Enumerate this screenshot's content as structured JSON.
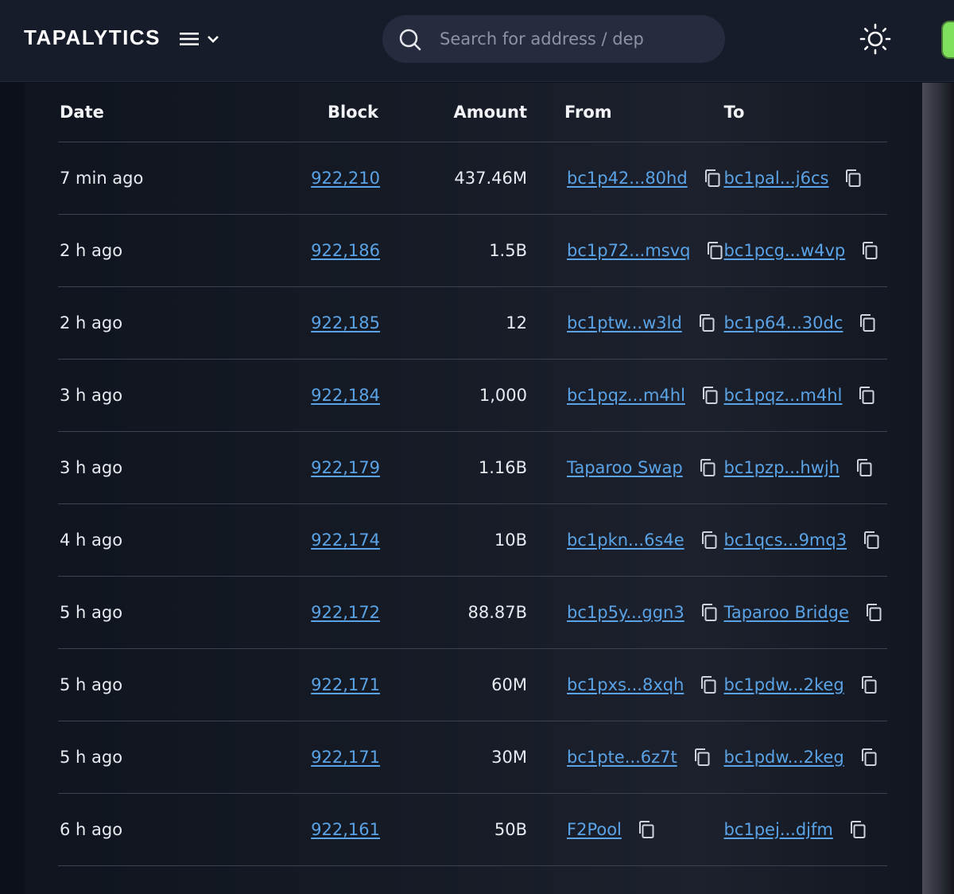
{
  "header": {
    "logo": "TAPALYTICS",
    "search_placeholder": "Search for address / depl"
  },
  "table": {
    "columns": [
      "Date",
      "Block",
      "Amount",
      "From",
      "To"
    ],
    "rows": [
      {
        "date": "7 min ago",
        "block": "922,210",
        "amount": "437.46M",
        "from": "bc1p42...80hd",
        "to": "bc1pal...j6cs"
      },
      {
        "date": "2 h ago",
        "block": "922,186",
        "amount": "1.5B",
        "from": "bc1p72...msvq",
        "to": "bc1pcg...w4vp"
      },
      {
        "date": "2 h ago",
        "block": "922,185",
        "amount": "12",
        "from": "bc1ptw...w3ld",
        "to": "bc1p64...30dc"
      },
      {
        "date": "3 h ago",
        "block": "922,184",
        "amount": "1,000",
        "from": "bc1pqz...m4hl",
        "to": "bc1pqz...m4hl"
      },
      {
        "date": "3 h ago",
        "block": "922,179",
        "amount": "1.16B",
        "from": "Taparoo Swap",
        "to": "bc1pzp...hwjh"
      },
      {
        "date": "4 h ago",
        "block": "922,174",
        "amount": "10B",
        "from": "bc1pkn...6s4e",
        "to": "bc1qcs...9mq3"
      },
      {
        "date": "5 h ago",
        "block": "922,172",
        "amount": "88.87B",
        "from": "bc1p5y...ggn3",
        "to": "Taparoo Bridge"
      },
      {
        "date": "5 h ago",
        "block": "922,171",
        "amount": "60M",
        "from": "bc1pxs...8xqh",
        "to": "bc1pdw...2keg"
      },
      {
        "date": "5 h ago",
        "block": "922,171",
        "amount": "30M",
        "from": "bc1pte...6z7t",
        "to": "bc1pdw...2keg"
      },
      {
        "date": "6 h ago",
        "block": "922,161",
        "amount": "50B",
        "from": "F2Pool",
        "to": "bc1pej...djfm"
      }
    ]
  }
}
